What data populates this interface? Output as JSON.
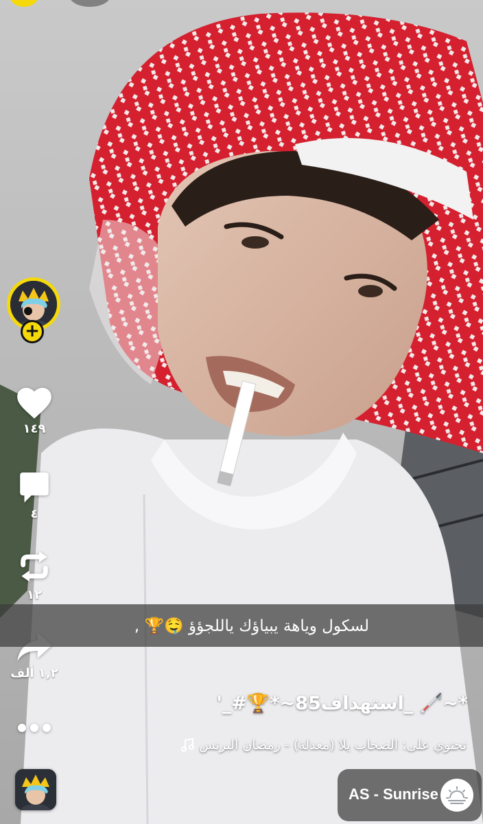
{
  "actions": {
    "likes": "١٤٩",
    "comments": "٤",
    "reposts": "١٢",
    "shares": "١,٢ ألف"
  },
  "caption": "لسكول وياهة يبياؤك ياللجؤؤ 🤤🏆 ,",
  "post_title": "*~🦯 _استهداف85~*🏆#_'",
  "sound": "تحتوي على: الصحاب يلا (معدلة) - رمضان البرنس",
  "sound_pill": {
    "label": "AS - Sunrise"
  },
  "colors": {
    "accent_yellow": "#f5d90a",
    "shemagh_red": "#d4202f"
  },
  "icons": [
    "heart-icon",
    "comment-icon",
    "repost-icon",
    "share-icon",
    "more-icon",
    "music-note-icon",
    "plus-icon",
    "sunrise-icon"
  ]
}
